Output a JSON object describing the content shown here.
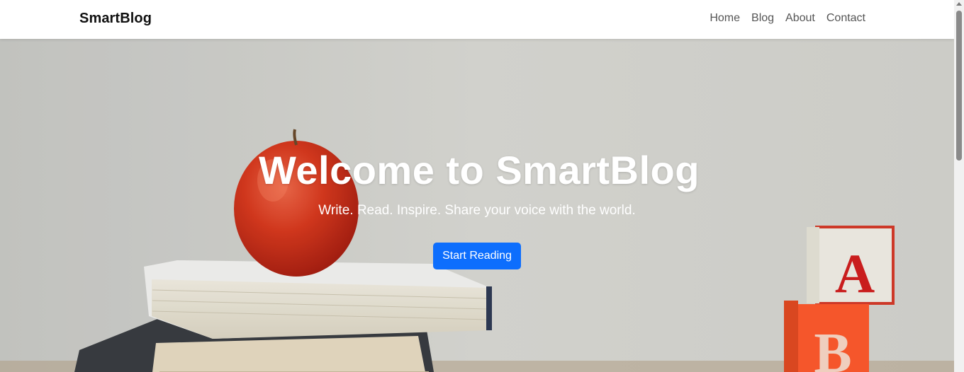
{
  "navbar": {
    "brand": "SmartBlog",
    "links": [
      {
        "label": "Home"
      },
      {
        "label": "Blog"
      },
      {
        "label": "About"
      },
      {
        "label": "Contact"
      }
    ]
  },
  "hero": {
    "title": "Welcome to SmartBlog",
    "subtitle": "Write. Read. Inspire. Share your voice with the world.",
    "cta_label": "Start Reading",
    "background_image": {
      "block_letters": [
        "A",
        "B"
      ]
    }
  },
  "colors": {
    "primary": "#0d6efd",
    "nav_text": "#555555",
    "brand_text": "#111111",
    "hero_text": "#ffffff"
  }
}
